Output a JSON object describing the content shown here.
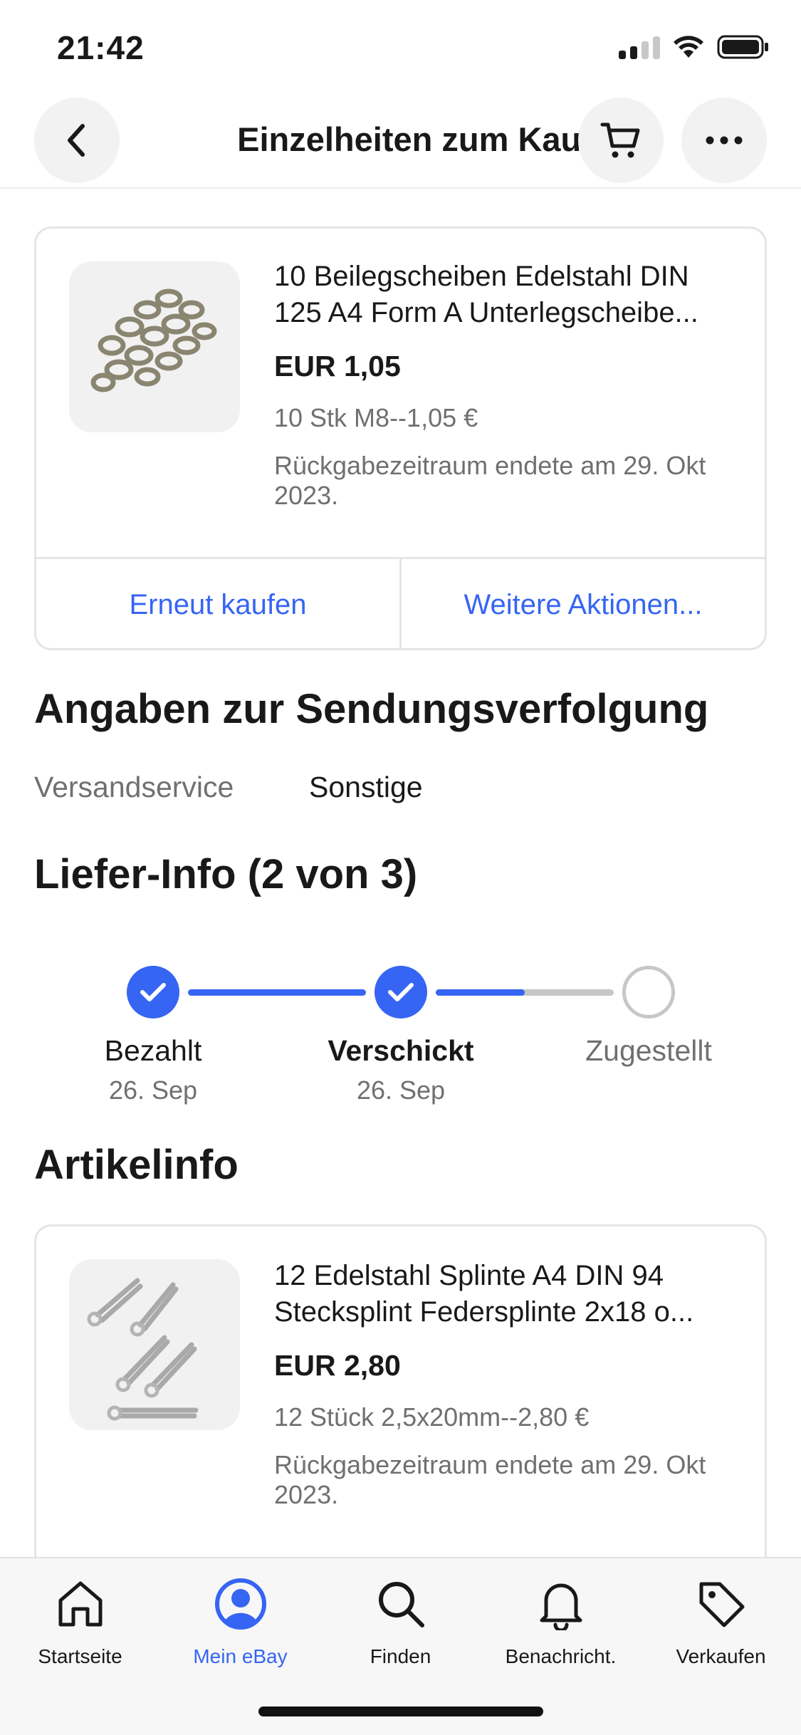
{
  "status_bar": {
    "time": "21:42"
  },
  "nav": {
    "title": "Einzelheiten zum Kauf",
    "back_icon": "chevron-left-icon",
    "cart_icon": "cart-icon",
    "more_icon": "more-horizontal-icon"
  },
  "order_item": {
    "title": "10 Beilegscheiben Edelstahl DIN 125 A4 Form A Unterlegscheibe...",
    "price": "EUR 1,05",
    "variant": "10 Stk M8--1,05 €",
    "return_info": "Rückgabezeitraum endete am 29. Okt 2023.",
    "actions": {
      "buy_again": "Erneut kaufen",
      "more_actions": "Weitere Aktionen..."
    }
  },
  "tracking": {
    "heading": "Angaben zur Sendungsverfolgung",
    "service_label": "Versandservice",
    "service_value": "Sonstige"
  },
  "delivery": {
    "heading": "Liefer-Info (2 von 3)",
    "steps": [
      {
        "label": "Bezahlt",
        "date": "26. Sep",
        "done": true
      },
      {
        "label": "Verschickt",
        "date": "26. Sep",
        "done": true
      },
      {
        "label": "Zugestellt",
        "date": "",
        "done": false
      }
    ],
    "progress_to_next": 0.5
  },
  "article_info": {
    "heading": "Artikelinfo",
    "item": {
      "title": "12 Edelstahl Splinte A4 DIN 94 Stecksplint Federsplinte 2x18 o...",
      "price": "EUR 2,80",
      "variant": "12 Stück 2,5x20mm--2,80 €",
      "return_info": "Rückgabezeitraum endete am 29. Okt 2023."
    }
  },
  "tab_bar": {
    "items": [
      {
        "label": "Startseite",
        "icon": "home-icon",
        "active": false
      },
      {
        "label": "Mein eBay",
        "icon": "user-icon",
        "active": true
      },
      {
        "label": "Finden",
        "icon": "search-icon",
        "active": false
      },
      {
        "label": "Benachricht.",
        "icon": "bell-icon",
        "active": false
      },
      {
        "label": "Verkaufen",
        "icon": "tag-icon",
        "active": false
      }
    ]
  },
  "colors": {
    "accent": "#3665f3",
    "muted": "#707070",
    "border": "#e5e5e5"
  }
}
